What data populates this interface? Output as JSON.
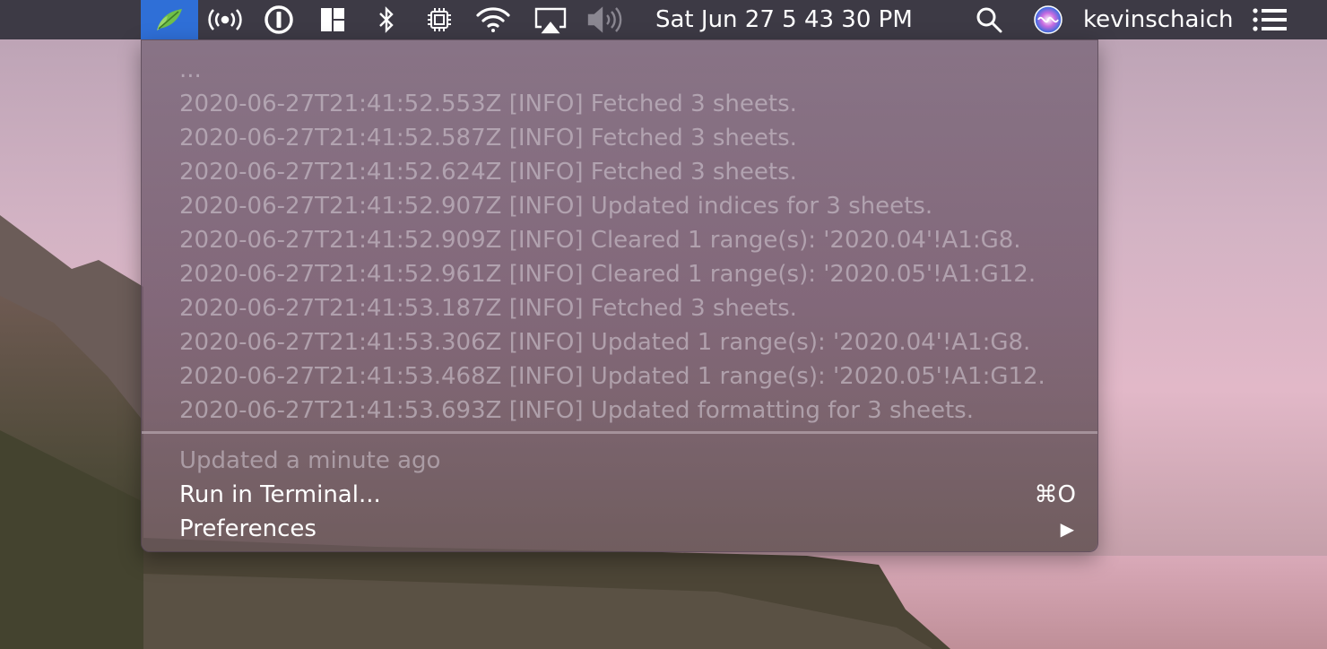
{
  "menubar": {
    "app_icon": "leaf-app-icon",
    "status_icons": [
      "broadcast-icon",
      "onepassword-icon",
      "window-layout-icon",
      "bluetooth-icon",
      "cpu-icon",
      "wifi-icon",
      "airplay-icon",
      "volume-icon"
    ],
    "clock": "Sat Jun 27  5 43 30 PM",
    "search_icon": "spotlight-search-icon",
    "siri_icon": "siri-icon",
    "username": "kevinschaich",
    "notification_icon": "notification-center-icon"
  },
  "menu": {
    "log_lines": [
      "...",
      "2020-06-27T21:41:52.553Z [INFO] Fetched 3 sheets.",
      "2020-06-27T21:41:52.587Z [INFO] Fetched 3 sheets.",
      "2020-06-27T21:41:52.624Z [INFO] Fetched 3 sheets.",
      "2020-06-27T21:41:52.907Z [INFO] Updated indices for 3 sheets.",
      "2020-06-27T21:41:52.909Z [INFO] Cleared 1 range(s): '2020.04'!A1:G8.",
      "2020-06-27T21:41:52.961Z [INFO] Cleared 1 range(s): '2020.05'!A1:G12.",
      "2020-06-27T21:41:53.187Z [INFO] Fetched 3 sheets.",
      "2020-06-27T21:41:53.306Z [INFO] Updated 1 range(s): '2020.04'!A1:G8.",
      "2020-06-27T21:41:53.468Z [INFO] Updated 1 range(s): '2020.05'!A1:G12.",
      "2020-06-27T21:41:53.693Z [INFO] Updated formatting for 3 sheets."
    ],
    "status": "Updated a minute ago",
    "run_label": "Run in Terminal...",
    "run_shortcut": "⌘O",
    "preferences_label": "Preferences",
    "submenu_arrow": "▶"
  }
}
